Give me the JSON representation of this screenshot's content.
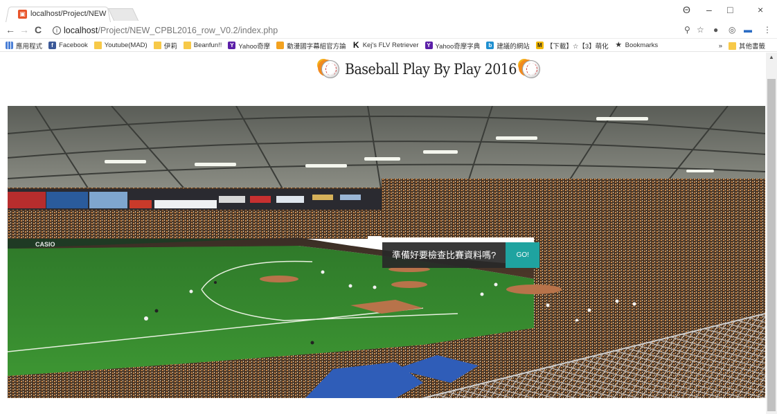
{
  "browser": {
    "tab": {
      "title": "localhost/Project/NEW",
      "close": "×"
    },
    "window_controls": {
      "profile": "Θ",
      "minimize": "–",
      "maximize": "□",
      "close": "×"
    },
    "nav": {
      "back": "←",
      "forward": "→",
      "reload": "C"
    },
    "url": {
      "host": "localhost",
      "path": "/Project/NEW_CPBL2016_row_V0.2/index.php"
    },
    "toolbar_icons": [
      "zoom-icon",
      "star-icon",
      "extension-icon",
      "extension-icon",
      "extension-icon",
      "menu-icon"
    ]
  },
  "bookmarks": {
    "items": [
      {
        "label": "應用程式",
        "icon": "apps-icon"
      },
      {
        "label": "Facebook",
        "icon": "facebook-icon"
      },
      {
        "label": "Youtube(MAD)",
        "icon": "folder-icon"
      },
      {
        "label": "伊莉",
        "icon": "folder-icon"
      },
      {
        "label": "Beanfun!!",
        "icon": "folder-icon"
      },
      {
        "label": "Yahoo奇摩",
        "icon": "yahoo-icon"
      },
      {
        "label": "動漫國字幕組官方論",
        "icon": "anime-icon"
      },
      {
        "label": "Kej's FLV Retriever",
        "icon": "k-icon"
      },
      {
        "label": "Yahoo奇摩字典",
        "icon": "yahoo-icon"
      },
      {
        "label": "建議的網站",
        "icon": "bing-icon"
      },
      {
        "label": "【下載】☆【3】萌化",
        "icon": "m-icon"
      },
      {
        "label": "Bookmarks",
        "icon": "star-icon"
      }
    ],
    "overflow": "»",
    "other": "其他書籤"
  },
  "page": {
    "logo_text": "Baseball Play By Play 2016",
    "cta_question": "準備好要檢查比賽資料嗎?",
    "cta_button": "GO!"
  }
}
